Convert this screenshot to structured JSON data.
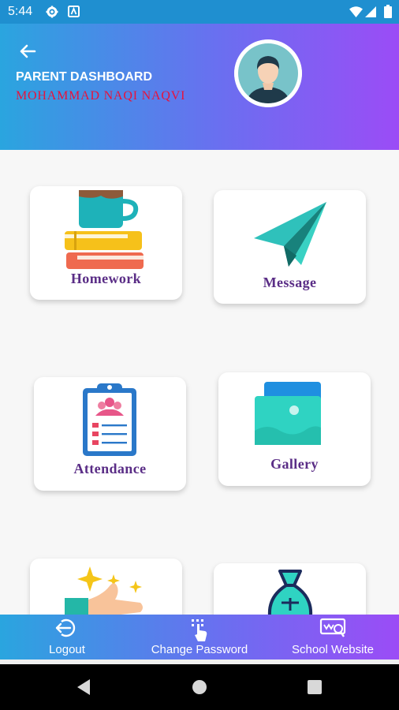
{
  "status": {
    "time": "5:44"
  },
  "header": {
    "title": "PARENT DASHBOARD",
    "student_name": "MOHAMMAD NAQI NAQVI"
  },
  "tiles": [
    {
      "label": "Homework",
      "icon": "homework-books-cup-icon"
    },
    {
      "label": "Message",
      "icon": "paper-plane-icon"
    },
    {
      "label": "Attendance",
      "icon": "clipboard-checklist-icon"
    },
    {
      "label": "Gallery",
      "icon": "photo-gallery-icon"
    },
    {
      "label": "",
      "icon": "hand-sparkles-icon"
    },
    {
      "label": "",
      "icon": "money-bag-icon"
    }
  ],
  "bottom_nav": {
    "logout": "Logout",
    "change_password": "Change Password",
    "school_website": "School Website"
  },
  "colors": {
    "gradient_start": "#2aa5df",
    "gradient_end": "#9b4cf6",
    "name_red": "#e8123c",
    "label_purple": "#5a2d86"
  }
}
